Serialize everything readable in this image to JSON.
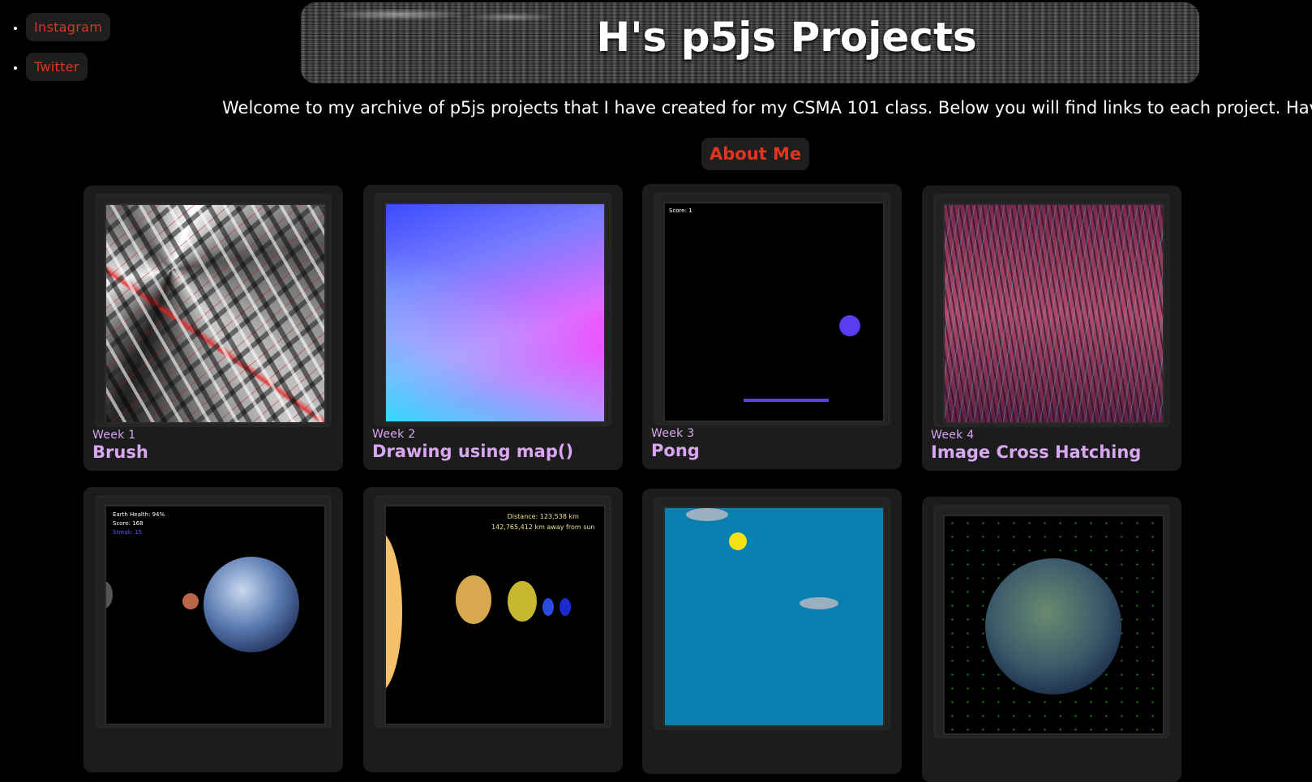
{
  "social": [
    {
      "label": "Instagram"
    },
    {
      "label": "Twitter"
    }
  ],
  "header": {
    "title": "H's p5js Projects"
  },
  "welcome": "Welcome to my archive of p5js projects that I have created for my CSMA 101 class. Below you will find links to each project. Have fun!",
  "about_button": "About Me",
  "projects": [
    {
      "week": "Week 1",
      "title": "Brush"
    },
    {
      "week": "Week 2",
      "title": "Drawing using map()"
    },
    {
      "week": "Week 3",
      "title": "Pong",
      "score_text": "Score: 1"
    },
    {
      "week": "Week 4",
      "title": "Image Cross Hatching"
    },
    {
      "hud": [
        "Earth Health: 94%",
        "Score: 168",
        "Streak: 15"
      ]
    },
    {
      "readout": [
        "Distance: 123,538 km",
        "142,765,412 km away from sun"
      ]
    },
    {},
    {}
  ],
  "colors": {
    "link_red": "#e0351e",
    "card_text": "#d9a6f2",
    "card_bg": "#1c1c1c"
  }
}
